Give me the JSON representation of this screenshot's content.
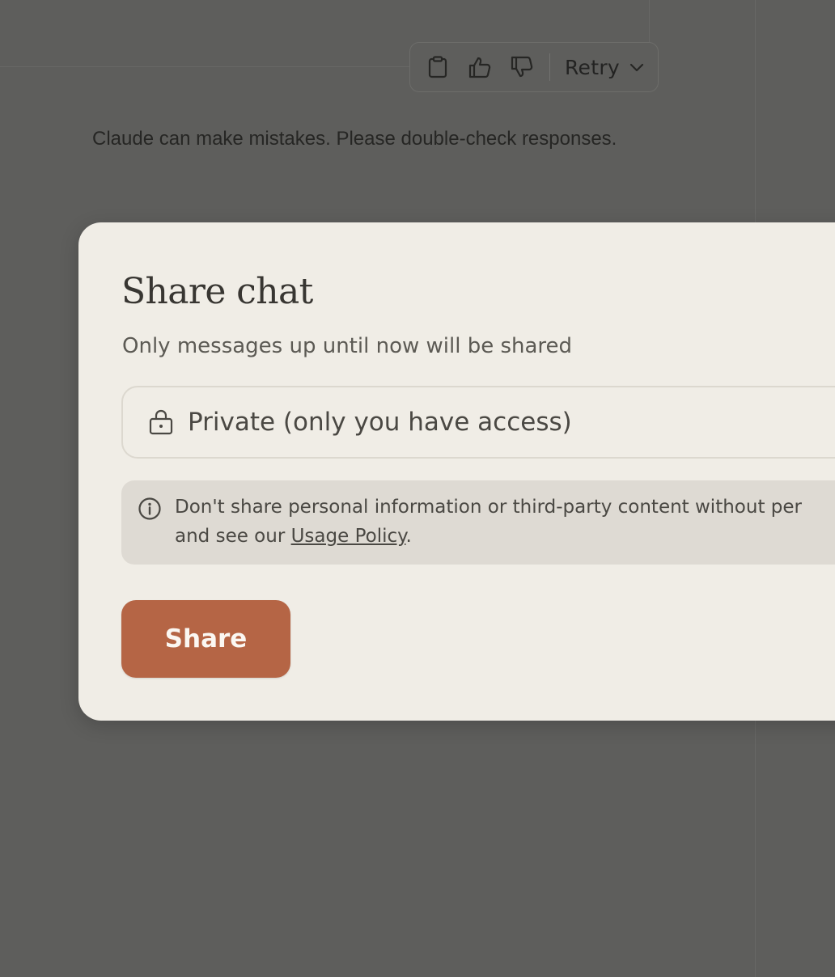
{
  "toolbar": {
    "icons": [
      "clipboard-icon",
      "thumbs-up-icon",
      "thumbs-down-icon",
      "chevron-down-icon"
    ],
    "retry_label": "Retry"
  },
  "disclaimer": "Claude can make mistakes. Please double-check responses.",
  "modal": {
    "title": "Share chat",
    "subtitle": "Only messages up until now will be shared",
    "visibility": {
      "icon": "lock-icon",
      "selected_label": "Private (only you have access)"
    },
    "notice": {
      "icon": "info-icon",
      "line1": "Don't share personal information or third-party content without per",
      "line2_prefix": "and see our ",
      "link_label": "Usage Policy",
      "line2_suffix": "."
    },
    "share_label": "Share"
  },
  "colors": {
    "backdrop": "#5e5e5c",
    "modal_bg": "#f0ede6",
    "notice_bg": "#dedad3",
    "accent": "#b56545"
  }
}
